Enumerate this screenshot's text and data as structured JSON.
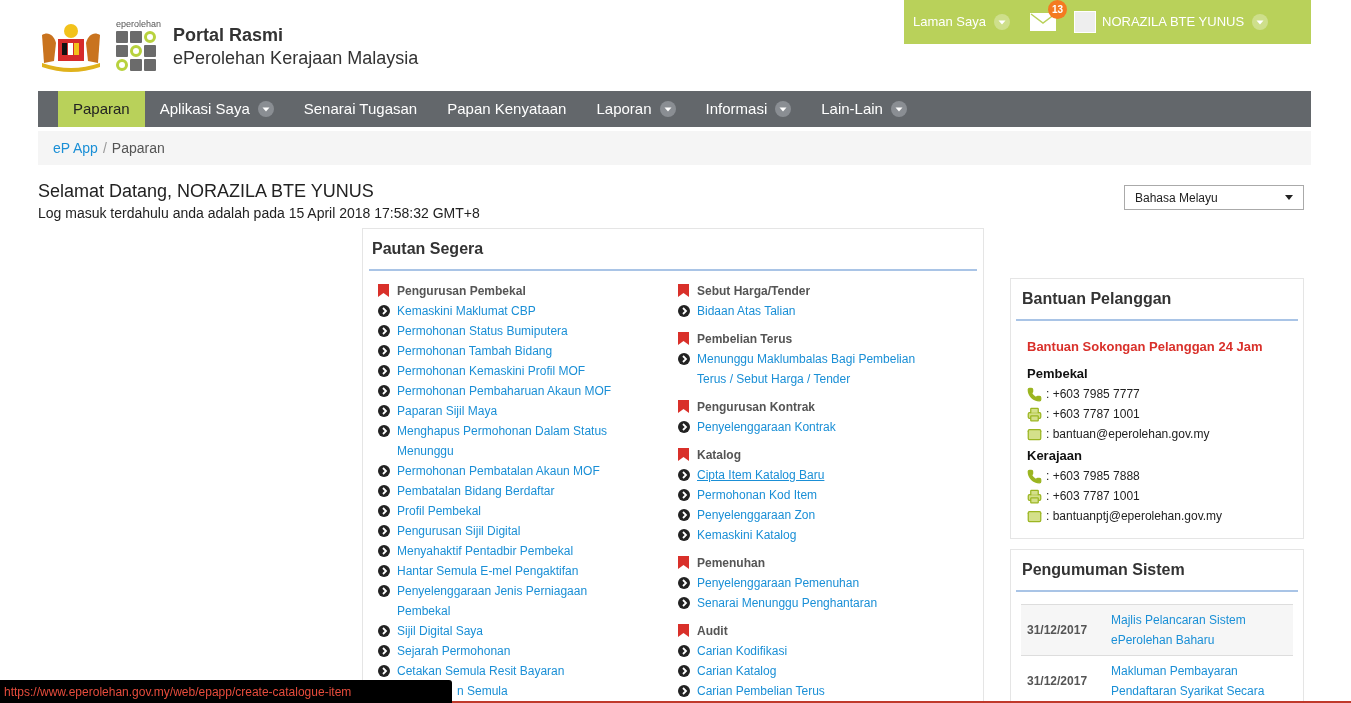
{
  "header": {
    "logo_caption": "eperolehan",
    "title": "Portal Rasmi",
    "subtitle": "ePerolehan Kerajaan Malaysia"
  },
  "top_bar": {
    "menu_label": "Laman Saya",
    "mail_count": "13",
    "user_name": "NORAZILA BTE YUNUS"
  },
  "nav": [
    {
      "label": "Paparan",
      "selected": true,
      "dropdown": false
    },
    {
      "label": "Aplikasi Saya",
      "selected": false,
      "dropdown": true
    },
    {
      "label": "Senarai Tugasan",
      "selected": false,
      "dropdown": false
    },
    {
      "label": "Papan Kenyataan",
      "selected": false,
      "dropdown": false
    },
    {
      "label": "Laporan",
      "selected": false,
      "dropdown": true
    },
    {
      "label": "Informasi",
      "selected": false,
      "dropdown": true
    },
    {
      "label": "Lain-Lain",
      "selected": false,
      "dropdown": true
    }
  ],
  "breadcrumb": {
    "separator": "/",
    "items": [
      {
        "label": "eP App",
        "link": true
      },
      {
        "label": "Paparan",
        "link": false
      }
    ]
  },
  "welcome": {
    "title": "Selamat Datang, NORAZILA BTE YUNUS",
    "last_login": "Log masuk terdahulu anda adalah pada 15 April 2018 17:58:32 GMT+8"
  },
  "language_select": {
    "value": "Bahasa Melayu"
  },
  "quick_links": {
    "title": "Pautan Segera",
    "columns": [
      [
        {
          "title": "Pengurusan Pembekal",
          "items": [
            {
              "label": "Kemaskini Maklumat CBP",
              "hovered": false,
              "kind": "link"
            },
            {
              "label": "Permohonan Status Bumiputera",
              "hovered": false,
              "kind": "link"
            },
            {
              "label": "Permohonan Tambah Bidang",
              "hovered": false,
              "kind": "link"
            },
            {
              "label": "Permohonan Kemaskini Profil MOF",
              "hovered": false,
              "kind": "link"
            },
            {
              "label": "Permohonan Pembaharuan Akaun MOF",
              "hovered": false,
              "kind": "link"
            },
            {
              "label": "Paparan Sijil Maya",
              "hovered": false,
              "kind": "link"
            },
            {
              "label": "Menghapus Permohonan Dalam Status Menunggu",
              "hovered": false,
              "kind": "link"
            },
            {
              "label": "Permohonan Pembatalan Akaun MOF",
              "hovered": false,
              "kind": "link"
            },
            {
              "label": "Pembatalan Bidang Berdaftar",
              "hovered": false,
              "kind": "link"
            },
            {
              "label": "Profil Pembekal",
              "hovered": false,
              "kind": "link"
            },
            {
              "label": "Pengurusan Sijil Digital",
              "hovered": false,
              "kind": "link"
            },
            {
              "label": "Menyahaktif Pentadbir Pembekal",
              "hovered": false,
              "kind": "link"
            },
            {
              "label": "Hantar Semula E-mel Pengaktifan",
              "hovered": false,
              "kind": "link"
            },
            {
              "label": "Penyelenggaraan Jenis Perniagaan Pembekal",
              "hovered": false,
              "kind": "link"
            },
            {
              "label": "Sijil Digital Saya",
              "hovered": false,
              "kind": "link"
            },
            {
              "label": "Sejarah Permohonan",
              "hovered": false,
              "kind": "link"
            },
            {
              "label": "Cetakan Semula Resit Bayaran",
              "hovered": false,
              "kind": "link"
            },
            {
              "label": "n Semula",
              "hovered": false,
              "kind": "covered"
            }
          ]
        }
      ],
      [
        {
          "title": "Sebut Harga/Tender",
          "items": [
            {
              "label": "Bidaan Atas Talian",
              "hovered": false,
              "kind": "link"
            }
          ]
        },
        {
          "title": "Pembelian Terus",
          "items": [
            {
              "label": "Menunggu Maklumbalas Bagi Pembelian Terus / Sebut Harga / Tender",
              "hovered": false,
              "kind": "link"
            }
          ]
        },
        {
          "title": "Pengurusan Kontrak",
          "items": [
            {
              "label": "Penyelenggaraan Kontrak",
              "hovered": false,
              "kind": "link"
            }
          ]
        },
        {
          "title": "Katalog",
          "items": [
            {
              "label": "Cipta Item Katalog Baru",
              "hovered": true,
              "kind": "link"
            },
            {
              "label": "Permohonan Kod Item",
              "hovered": false,
              "kind": "link"
            },
            {
              "label": "Penyelenggaraan Zon",
              "hovered": false,
              "kind": "link"
            },
            {
              "label": "Kemaskini Katalog",
              "hovered": false,
              "kind": "link"
            }
          ]
        },
        {
          "title": "Pemenuhan",
          "items": [
            {
              "label": "Penyelenggaraan Pemenuhan",
              "hovered": false,
              "kind": "link"
            },
            {
              "label": "Senarai Menunggu Penghantaran",
              "hovered": false,
              "kind": "link"
            }
          ]
        },
        {
          "title": "Audit",
          "items": [
            {
              "label": "Carian Kodifikasi",
              "hovered": false,
              "kind": "link"
            },
            {
              "label": "Carian Katalog",
              "hovered": false,
              "kind": "link"
            },
            {
              "label": "Carian Pembelian Terus",
              "hovered": false,
              "kind": "link"
            }
          ]
        }
      ]
    ]
  },
  "help": {
    "title": "Bantuan Pelanggan",
    "headline": "Bantuan Sokongan Pelanggan 24 Jam",
    "groups": [
      {
        "title": "Pembekal",
        "contacts": [
          {
            "kind": "phone",
            "value": ": +603 7985 7777"
          },
          {
            "kind": "fax",
            "value": ": +603 7787 1001"
          },
          {
            "kind": "email",
            "value": ": bantuan@eperolehan.gov.my"
          }
        ]
      },
      {
        "title": "Kerajaan",
        "contacts": [
          {
            "kind": "phone",
            "value": ": +603 7985 7888"
          },
          {
            "kind": "fax",
            "value": ": +603 7787 1001"
          },
          {
            "kind": "email",
            "value": ": bantuanptj@eperolehan.gov.my"
          }
        ]
      }
    ]
  },
  "announcements": {
    "title": "Pengumuman Sistem",
    "rows": [
      {
        "date": "31/12/2017",
        "text": "Majlis Pelancaran Sistem ePerolehan Baharu"
      },
      {
        "date": "31/12/2017",
        "text": "Makluman Pembayaran Pendaftaran Syarikat Secara"
      }
    ]
  },
  "status_bar": {
    "url": "https://www.eperolehan.gov.my/web/epapp/create-catalogue-item"
  }
}
